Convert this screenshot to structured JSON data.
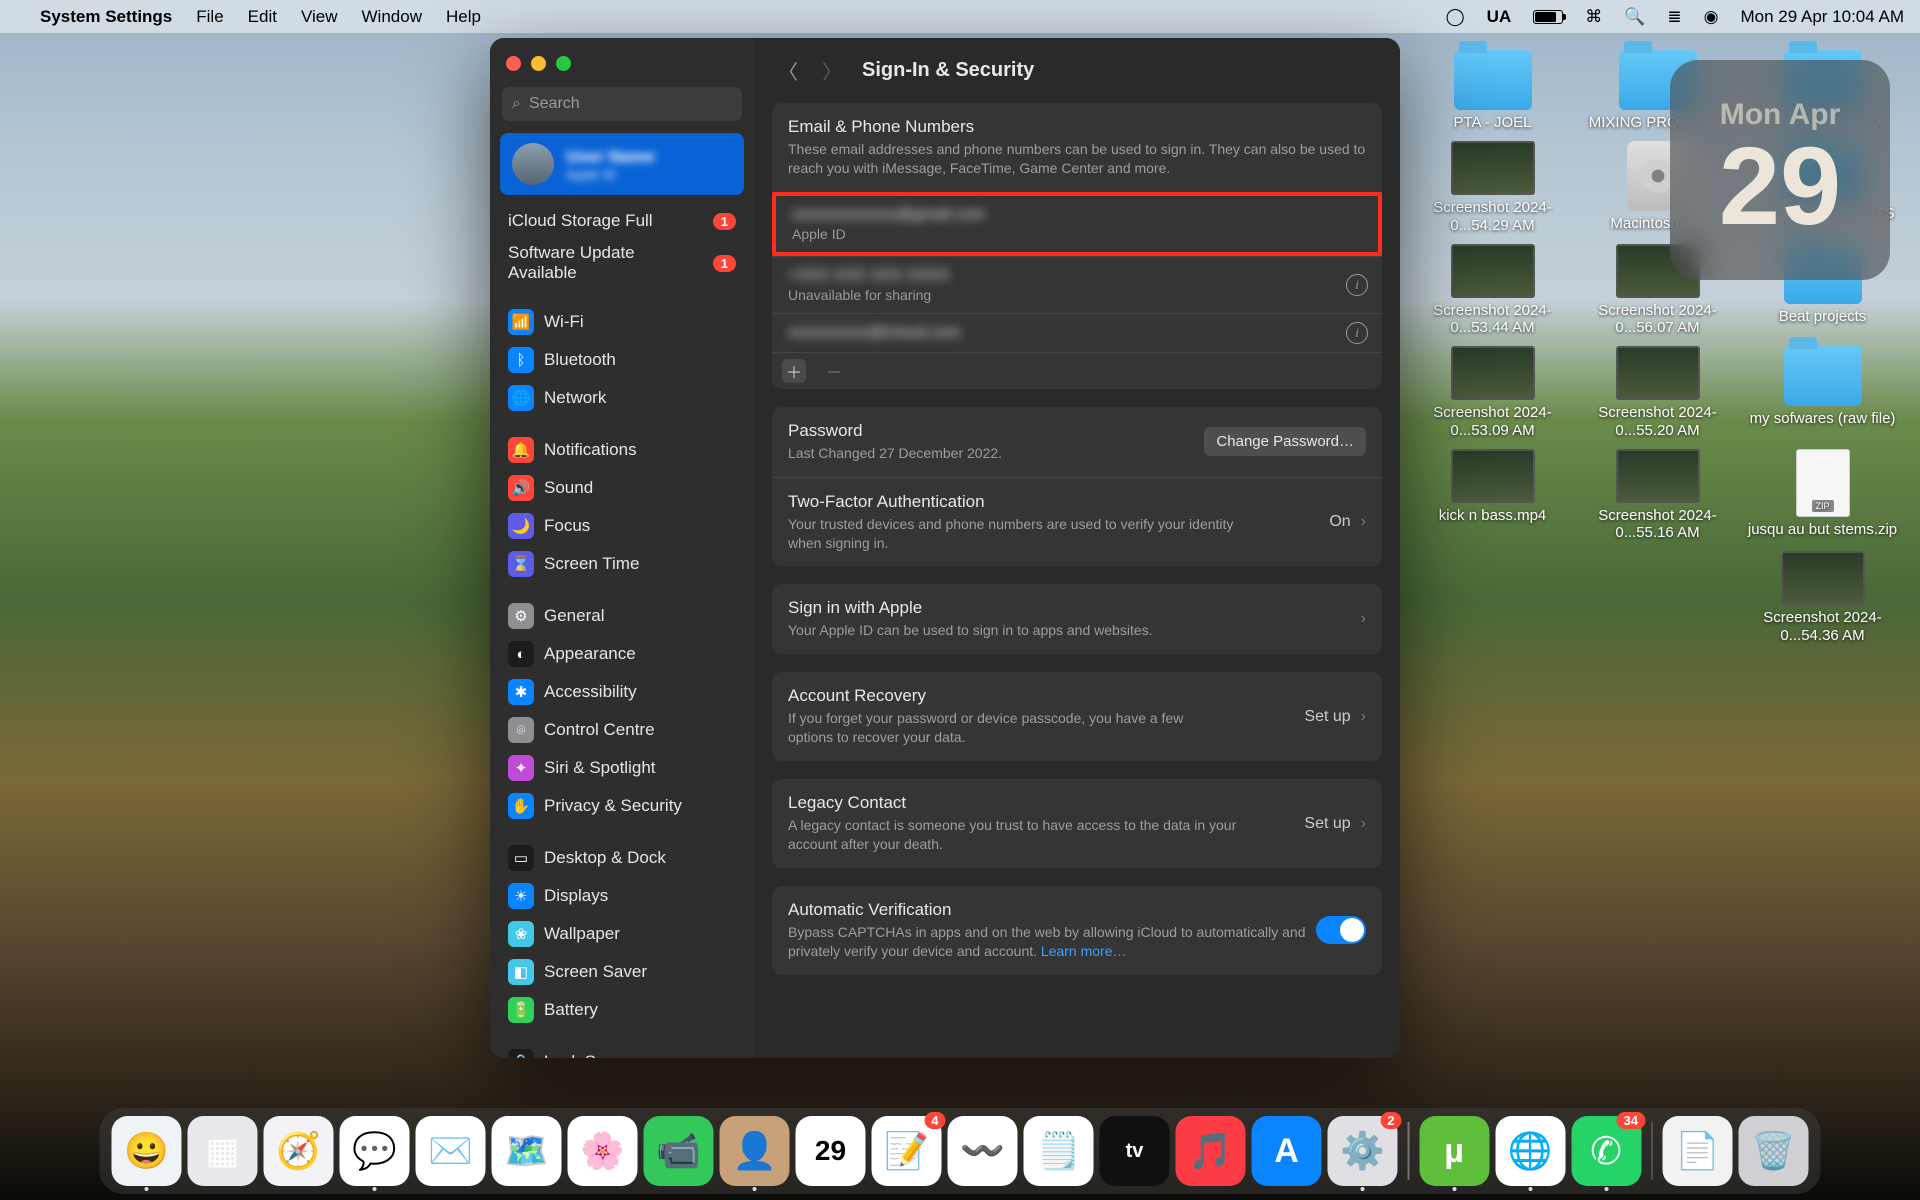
{
  "menubar": {
    "app": "System Settings",
    "items": [
      "File",
      "Edit",
      "View",
      "Window",
      "Help"
    ],
    "input_lang": "UA",
    "clock": "Mon 29 Apr  10:04 AM"
  },
  "date_widget": {
    "dow": "Mon",
    "mon": "Apr",
    "day": "29"
  },
  "desktop_icons": [
    {
      "type": "folder",
      "label": "PTA - JOEL"
    },
    {
      "type": "folder",
      "label": "MIXING PROJECTS"
    },
    {
      "type": "folder",
      "label": "UNFINISHED MIX"
    },
    {
      "type": "img",
      "label": "Screenshot 2024-0...54.29 AM"
    },
    {
      "type": "hd",
      "label": "Macintosh HD"
    },
    {
      "type": "folder",
      "label": "UNFINISHED BEATS"
    },
    {
      "type": "img",
      "label": "Screenshot 2024-0...53.44 AM"
    },
    {
      "type": "img",
      "label": "Screenshot 2024-0...56.07 AM"
    },
    {
      "type": "folder",
      "label": "Beat projects"
    },
    {
      "type": "img",
      "label": "Screenshot 2024-0...53.09 AM"
    },
    {
      "type": "img",
      "label": "Screenshot 2024-0...55.20 AM"
    },
    {
      "type": "folder",
      "label": "my sofwares (raw file)"
    },
    {
      "type": "img",
      "label": "kick n bass.mp4"
    },
    {
      "type": "img",
      "label": "Screenshot 2024-0...55.16 AM"
    },
    {
      "type": "zip",
      "label": "jusqu au but stems.zip"
    },
    {
      "type": "img",
      "label": "Screenshot 2024-0...54.36 AM"
    }
  ],
  "settings": {
    "search_placeholder": "Search",
    "account": {
      "name": "User Name",
      "sub": "Apple ID"
    },
    "notices": [
      {
        "label": "iCloud Storage Full",
        "badge": "1"
      },
      {
        "label": "Software Update Available",
        "badge": "1"
      }
    ],
    "nav": [
      {
        "icon": "📶",
        "bg": "#0a84ff",
        "label": "Wi-Fi"
      },
      {
        "icon": "ᛒ",
        "bg": "#0a84ff",
        "label": "Bluetooth"
      },
      {
        "icon": "🌐",
        "bg": "#0a84ff",
        "label": "Network"
      },
      {
        "gap": true
      },
      {
        "icon": "🔔",
        "bg": "#ff453a",
        "label": "Notifications"
      },
      {
        "icon": "🔊",
        "bg": "#ff453a",
        "label": "Sound"
      },
      {
        "icon": "🌙",
        "bg": "#5e5ce6",
        "label": "Focus"
      },
      {
        "icon": "⌛",
        "bg": "#5e5ce6",
        "label": "Screen Time"
      },
      {
        "gap": true
      },
      {
        "icon": "⚙",
        "bg": "#8e8e93",
        "label": "General"
      },
      {
        "icon": "◐",
        "bg": "#1c1c1e",
        "label": "Appearance"
      },
      {
        "icon": "✱",
        "bg": "#0a84ff",
        "label": "Accessibility"
      },
      {
        "icon": "⌾",
        "bg": "#8e8e93",
        "label": "Control Centre"
      },
      {
        "icon": "✦",
        "bg": "#c04bd6",
        "label": "Siri & Spotlight"
      },
      {
        "icon": "✋",
        "bg": "#0a84ff",
        "label": "Privacy & Security"
      },
      {
        "gap": true
      },
      {
        "icon": "▭",
        "bg": "#1c1c1e",
        "label": "Desktop & Dock"
      },
      {
        "icon": "☀",
        "bg": "#0a84ff",
        "label": "Displays"
      },
      {
        "icon": "❀",
        "bg": "#44c8e8",
        "label": "Wallpaper"
      },
      {
        "icon": "◧",
        "bg": "#44c8e8",
        "label": "Screen Saver"
      },
      {
        "icon": "🔋",
        "bg": "#30d158",
        "label": "Battery"
      },
      {
        "gap": true
      },
      {
        "icon": "🔒",
        "bg": "#1c1c1e",
        "label": "Lock Screen"
      }
    ],
    "main": {
      "title": "Sign-In & Security",
      "email_section": {
        "title": "Email & Phone Numbers",
        "sub": "These email addresses and phone numbers can be used to sign in. They can also be used to reach you with iMessage, FaceTime, Game Center and more.",
        "rows": [
          {
            "title": "xxxxxxxxxxxxx@gmail.com",
            "sub": "Apple ID",
            "info": false,
            "highlight": true,
            "blur_title": true
          },
          {
            "title": "+XXX XXX XXX XXXX",
            "sub": "Unavailable for sharing",
            "info": true,
            "blur_title": true
          },
          {
            "title": "xxxxxxxxxx@icloud.com",
            "sub": "",
            "info": true,
            "blur_title": true
          }
        ]
      },
      "password": {
        "title": "Password",
        "sub": "Last Changed 27 December 2022.",
        "button": "Change Password…"
      },
      "twofa": {
        "title": "Two-Factor Authentication",
        "value": "On",
        "sub": "Your trusted devices and phone numbers are used to verify your identity when signing in."
      },
      "siwa": {
        "title": "Sign in with Apple",
        "sub": "Your Apple ID can be used to sign in to apps and websites."
      },
      "recovery": {
        "title": "Account Recovery",
        "value": "Set up",
        "sub": "If you forget your password or device passcode, you have a few options to recover your data."
      },
      "legacy": {
        "title": "Legacy Contact",
        "value": "Set up",
        "sub": "A legacy contact is someone you trust to have access to the data in your account after your death."
      },
      "auto": {
        "title": "Automatic Verification",
        "sub": "Bypass CAPTCHAs in apps and on the web by allowing iCloud to automatically and privately verify your device and account. ",
        "link": "Learn more…"
      }
    }
  },
  "dock": [
    {
      "bg": "#eef3f7",
      "emoji": "😀",
      "name": "finder",
      "running": true
    },
    {
      "bg": "#e9e9ed",
      "emoji": "▦",
      "name": "launchpad"
    },
    {
      "bg": "#f3f3f7",
      "emoji": "🧭",
      "name": "safari"
    },
    {
      "bg": "#ffffff",
      "emoji": "💬",
      "name": "messages",
      "running": true
    },
    {
      "bg": "#ffffff",
      "emoji": "✉️",
      "name": "mail"
    },
    {
      "bg": "#ffffff",
      "emoji": "🗺️",
      "name": "maps"
    },
    {
      "bg": "#ffffff",
      "emoji": "🌸",
      "name": "photos"
    },
    {
      "bg": "#34c759",
      "emoji": "📹",
      "name": "facetime"
    },
    {
      "bg": "#c7a17a",
      "emoji": "👤",
      "name": "contacts",
      "running": true
    },
    {
      "bg": "#ffffff",
      "emoji": "📅",
      "name": "calendar",
      "text": "29"
    },
    {
      "bg": "#ffffff",
      "emoji": "📝",
      "name": "reminders",
      "badge": "4"
    },
    {
      "bg": "#ffffff",
      "emoji": "〰️",
      "name": "freeform"
    },
    {
      "bg": "#ffffff",
      "emoji": "🗒️",
      "name": "notes"
    },
    {
      "bg": "#101010",
      "emoji": "tv",
      "name": "appletv"
    },
    {
      "bg": "#fc3c44",
      "emoji": "🎵",
      "name": "music"
    },
    {
      "bg": "#0a84ff",
      "emoji": "A",
      "name": "appstore"
    },
    {
      "bg": "#e0e0e4",
      "emoji": "⚙️",
      "name": "settings",
      "badge": "2",
      "running": true
    },
    {
      "sep": true
    },
    {
      "bg": "#5fbf3b",
      "emoji": "µ",
      "name": "utorrent",
      "running": true
    },
    {
      "bg": "#ffffff",
      "emoji": "🌐",
      "name": "chrome",
      "running": true
    },
    {
      "bg": "#25d366",
      "emoji": "✆",
      "name": "whatsapp",
      "badge": "34",
      "running": true
    },
    {
      "sep": true
    },
    {
      "bg": "#f2f2f2",
      "emoji": "📄",
      "name": "doc"
    },
    {
      "bg": "#d0d0d4",
      "emoji": "🗑️",
      "name": "trash"
    }
  ]
}
